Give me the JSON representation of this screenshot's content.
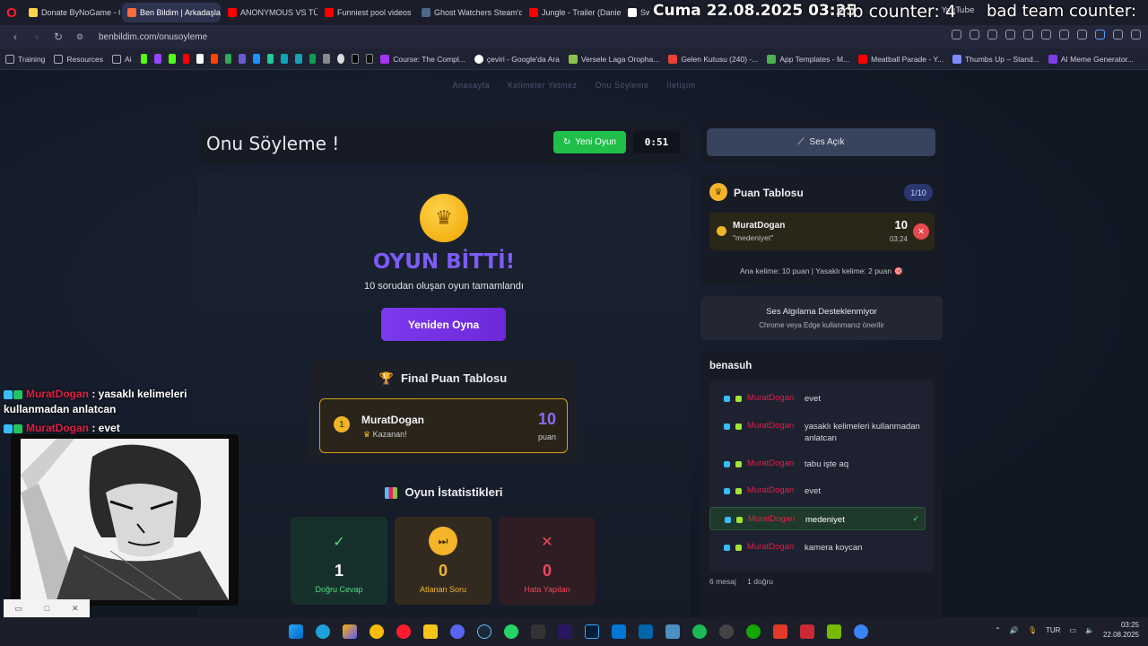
{
  "browser": {
    "tabs": [
      {
        "label": "Donate ByNoGame - Gel",
        "color": "#ffd24a"
      },
      {
        "label": "Ben Bildim | Arkadaşlarını",
        "color": "#ff6b3d",
        "active": true
      },
      {
        "label": "ANONYMOUS VS TÜRKİY",
        "color": "#ff0000"
      },
      {
        "label": "Funniest pool videos",
        "color": "#ff0000"
      },
      {
        "label": "Ghost Watchers Steam'de",
        "color": "#1b2838"
      },
      {
        "label": "Jungle - Trailer (Daniel R",
        "color": "#ff0000"
      },
      {
        "label": "Sw",
        "color": "#ffffff"
      }
    ],
    "overlay_date": "Cuma 22.08.2025 03:25",
    "overlay_counter": "mb counter: 4",
    "overlay_bad": "bad team counter:",
    "overlay_youtube": "YouTube",
    "url": "benbildim.com/onusoyleme",
    "bookmarks": [
      {
        "label": "Training"
      },
      {
        "label": "Resources"
      },
      {
        "label": "Ai"
      },
      {
        "label": "Course: The Compl..."
      },
      {
        "label": "çeviri - Google'da Ara"
      },
      {
        "label": "Versele Laga Oropha..."
      },
      {
        "label": "Gelen Kutusu (240) -..."
      },
      {
        "label": "App Templates - M..."
      },
      {
        "label": "Meatball Parade - Y..."
      },
      {
        "label": "Thumbs Up – Stand..."
      },
      {
        "label": "AI Meme Generator..."
      }
    ]
  },
  "nav": [
    "Anasayfa",
    "Kelimeler Yetmez",
    "Onu Söyleme",
    "İletişim"
  ],
  "game": {
    "title": "Onu Söyleme !",
    "new_game": "Yeni Oyun",
    "timer": "0:51",
    "over_title": "OYUN BİTTİ!",
    "over_sub": "10 sorudan oluşan oyun tamamlandı",
    "replay": "Yeniden Oyna",
    "final_title": "Final Puan Tablosu",
    "final": {
      "rank": "1",
      "name": "MuratDogan",
      "status": "Kazanan!",
      "score": "10",
      "unit": "puan"
    },
    "stats_title": "Oyun İstatistikleri",
    "stats": [
      {
        "icon": "✓",
        "value": "1",
        "label": "Doğru Cevap"
      },
      {
        "icon": "⏭",
        "value": "0",
        "label": "Atlanan Soru"
      },
      {
        "icon": "✕",
        "value": "0",
        "label": "Hata Yapılan"
      }
    ]
  },
  "sidebar": {
    "sound": "Ses Açık",
    "score_title": "Puan Tablosu",
    "score_badge": "1/10",
    "entry": {
      "name": "MuratDogan",
      "word": "\"medeniyet\"",
      "score": "10",
      "time": "03:24"
    },
    "rules": "Ana kelime: 10 puan | Yasaklı kelime: 2 puan 🎯",
    "voice_title": "Ses Algılama Desteklenmiyor",
    "voice_sub": "Chrome veya Edge kullanmanız önerilir",
    "chat_title": "benasuh",
    "chat": [
      {
        "user": "MuratDogan",
        "msg": "evet"
      },
      {
        "user": "MuratDogan",
        "msg": "yasaklı kelimeleri kullanmadan anlatcan"
      },
      {
        "user": "MuratDogan",
        "msg": "tabu işte aq"
      },
      {
        "user": "MuratDogan",
        "msg": "evet"
      },
      {
        "user": "MuratDogan",
        "msg": "medeniyet",
        "correct": true
      },
      {
        "user": "MuratDogan",
        "msg": "kamera koycan"
      }
    ],
    "chat_count": "6 mesaj",
    "chat_correct": "1 doğru"
  },
  "stream_chat": [
    {
      "user": "MuratDogan",
      "msg": ": yasaklı kelimeleri kullanmadan anlatcan"
    },
    {
      "user": "MuratDogan",
      "msg": ": evet"
    }
  ],
  "taskbar": {
    "lang": "TUR",
    "time": "03:25",
    "date": "22.08.2025"
  }
}
